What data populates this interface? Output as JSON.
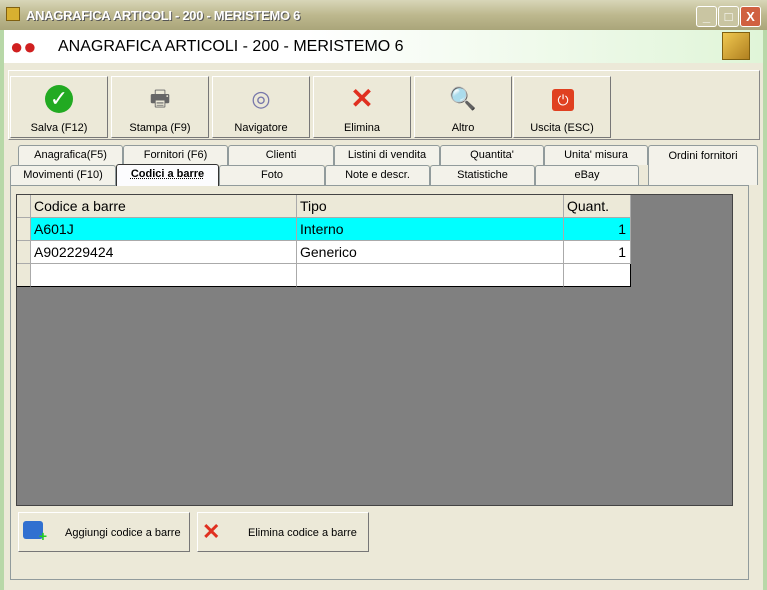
{
  "window": {
    "title": "ANAGRAFICA ARTICOLI - 200 - MERISTEMO 6",
    "minimize": "_",
    "maximize": "□",
    "close": "X"
  },
  "header": {
    "title": "ANAGRAFICA ARTICOLI - 200 - MERISTEMO 6"
  },
  "toolbar": [
    {
      "label": "Salva (F12)",
      "icon": "check-icon"
    },
    {
      "label": "Stampa (F9)",
      "icon": "printer-icon"
    },
    {
      "label": "Navigatore",
      "icon": "compass-icon"
    },
    {
      "label": "Elimina",
      "icon": "delete-icon"
    },
    {
      "label": "Altro",
      "icon": "search-book-icon"
    },
    {
      "label": "Uscita (ESC)",
      "icon": "power-icon"
    }
  ],
  "tabs_row1": [
    "Anagrafica(F5)",
    "Fornitori (F6)",
    "Clienti",
    "Listini di vendita",
    "Quantita'",
    "Unita' misura",
    "Ordini fornitori"
  ],
  "tabs_row2": [
    "Movimenti (F10)",
    "Codici a barre",
    "Foto",
    "Note e descr.",
    "Statistiche",
    "eBay"
  ],
  "selected_tab": "Codici a barre",
  "grid": {
    "columns": [
      "Codice a barre",
      "Tipo",
      "Quant."
    ],
    "rows": [
      [
        "A601J",
        "Interno",
        "1"
      ],
      [
        "A902229424",
        "Generico",
        "1"
      ]
    ]
  },
  "buttons": {
    "add": "Aggiungi codice a barre",
    "delete": "Elimina codice a barre"
  }
}
